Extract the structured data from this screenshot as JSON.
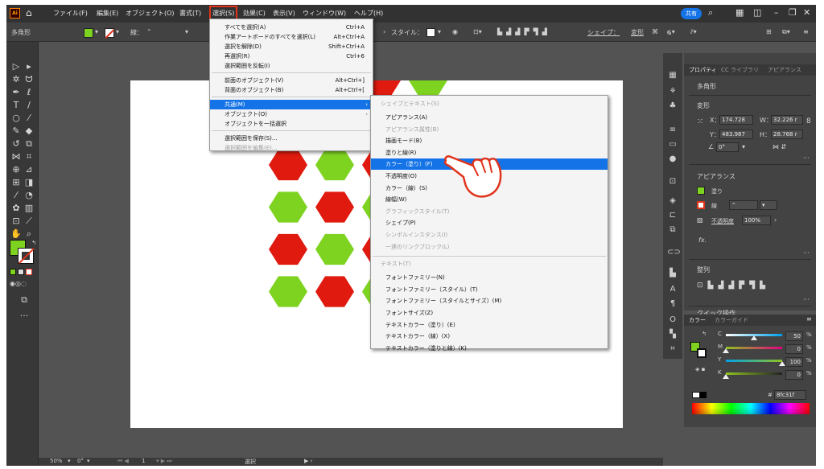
{
  "menubar": {
    "items": [
      "ファイル(F)",
      "編集(E)",
      "オブジェクト(O)",
      "書式(T)",
      "選択(S)",
      "効果(C)",
      "表示(V)",
      "ウィンドウ(W)",
      "ヘルプ(H)"
    ],
    "share": "共有"
  },
  "controlbar": {
    "shape_label": "多角形",
    "stroke_label": "線：",
    "style_label": "スタイル：",
    "shape_link": "シェイプ：",
    "transform": "変形"
  },
  "select_menu": {
    "items": [
      {
        "label": "すべてを選択(A)",
        "shortcut": "Ctrl+A"
      },
      {
        "label": "作業アートボードのすべてを選択(L)",
        "shortcut": "Alt+Ctrl+A"
      },
      {
        "label": "選択を解除(D)",
        "shortcut": "Shift+Ctrl+A"
      },
      {
        "label": "再選択(R)",
        "shortcut": "Ctrl+6"
      },
      {
        "label": "選択範囲を反転(I)",
        "shortcut": ""
      },
      {
        "label": "前面のオブジェクト(V)",
        "shortcut": "Alt+Ctrl+]"
      },
      {
        "label": "背面のオブジェクト(B)",
        "shortcut": "Alt+Ctrl+["
      },
      {
        "label": "共通(M)",
        "shortcut": ""
      },
      {
        "label": "オブジェクト(O)",
        "shortcut": ""
      },
      {
        "label": "オブジェクトを一括選択",
        "shortcut": ""
      },
      {
        "label": "選択範囲を保存(S)...",
        "shortcut": ""
      },
      {
        "label": "選択範囲を編集(E)...",
        "shortcut": ""
      }
    ]
  },
  "common_submenu": {
    "header1": "シェイプとテキスト(S)",
    "items1": [
      "アピアランス(A)",
      "アピアランス属性(B)",
      "描画モード(B)",
      "塗りと線(R)",
      "カラー（塗り）(F)",
      "不透明度(O)",
      "カラー（線）(S)",
      "線幅(W)",
      "グラフィックスタイル(T)",
      "シェイプ(P)",
      "シンボルインスタンス(I)",
      "一連のリンクブロック(L)"
    ],
    "header2": "テキスト(T)",
    "items2": [
      "フォントファミリー(N)",
      "フォントファミリー（スタイル）(T)",
      "フォントファミリー（スタイルとサイズ）(M)",
      "フォントサイズ(Z)",
      "テキストカラー（塗り）(E)",
      "テキストカラー（線）(X)",
      "テキストカラー（塗りと線）(K)"
    ]
  },
  "properties": {
    "tabs": [
      "プロパティ",
      "CC ライブラリ",
      "アピアランス"
    ],
    "object_type": "多角形",
    "transform_title": "変形",
    "x_label": "X：",
    "x_value": "174.728",
    "y_label": "Y：",
    "y_value": "483.987",
    "w_label": "W：",
    "w_value": "32.226 r",
    "h_label": "H：",
    "h_value": "28.768 r",
    "angle": "0°",
    "appearance_title": "アピアランス",
    "fill_label": "塗り",
    "stroke_label": "線",
    "opacity_label": "不透明度",
    "opacity_value": "100%",
    "fx_label": "fx.",
    "align_title": "整列",
    "quick_actions": "クイック操作"
  },
  "color_panel": {
    "tabs": [
      "カラー",
      "カラーガイド"
    ],
    "channels": [
      {
        "name": "C",
        "value": "50",
        "unit": "%",
        "pos": 0.5
      },
      {
        "name": "M",
        "value": "0",
        "unit": "%",
        "pos": 0.0
      },
      {
        "name": "Y",
        "value": "100",
        "unit": "%",
        "pos": 1.0
      },
      {
        "name": "K",
        "value": "0",
        "unit": "%",
        "pos": 0.0
      }
    ],
    "hex_label": "#",
    "hex_value": "8fc31f"
  },
  "statusbar": {
    "zoom": "50%",
    "rotation": "0°",
    "artboard": "1",
    "tool": "選択"
  },
  "colors": {
    "green": "#7ed321",
    "red": "#e01a0f",
    "accent": "#1473e6",
    "highlight_border": "#e0331b"
  },
  "hexagon_grid": [
    [
      "g",
      "g",
      "r",
      "g"
    ],
    [
      "g",
      "r",
      "g",
      "r"
    ],
    [
      "r",
      "g",
      "r",
      "g"
    ],
    [
      "g",
      "r",
      "g",
      "r"
    ],
    [
      "r",
      "g",
      "r",
      "g"
    ],
    [
      "g",
      "r",
      "g",
      "r",
      "g"
    ]
  ]
}
